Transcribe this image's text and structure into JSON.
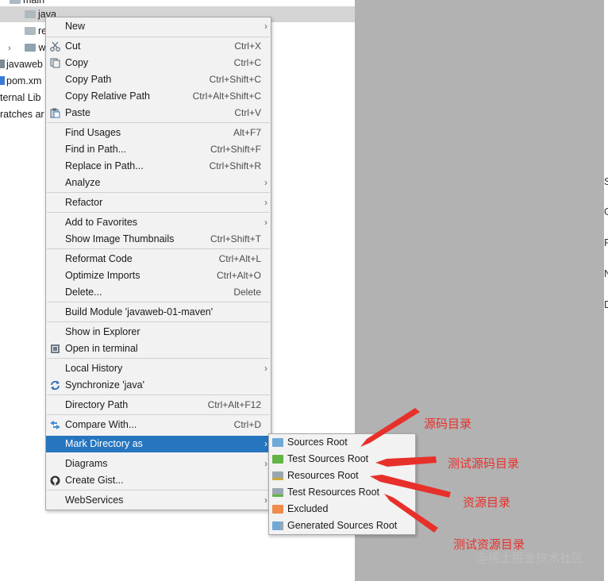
{
  "tree": {
    "main": "main",
    "java": "java",
    "re": "re",
    "w": "w",
    "javaweb": "javaweb",
    "pom": "pom.xm",
    "libs": "ternal Lib",
    "scratches": "ratches ar"
  },
  "editor_strip": [
    "S",
    "G",
    "R",
    "N",
    "D"
  ],
  "menu": {
    "new": "New",
    "cut": "Cut",
    "cut_sc": "Ctrl+X",
    "copy": "Copy",
    "copy_sc": "Ctrl+C",
    "copy_path": "Copy Path",
    "copy_path_sc": "Ctrl+Shift+C",
    "copy_rel": "Copy Relative Path",
    "copy_rel_sc": "Ctrl+Alt+Shift+C",
    "paste": "Paste",
    "paste_sc": "Ctrl+V",
    "find_usages": "Find Usages",
    "find_usages_sc": "Alt+F7",
    "find_in_path": "Find in Path...",
    "find_in_path_sc": "Ctrl+Shift+F",
    "replace_in_path": "Replace in Path...",
    "replace_in_path_sc": "Ctrl+Shift+R",
    "analyze": "Analyze",
    "refactor": "Refactor",
    "add_fav": "Add to Favorites",
    "thumbs": "Show Image Thumbnails",
    "thumbs_sc": "Ctrl+Shift+T",
    "reformat": "Reformat Code",
    "reformat_sc": "Ctrl+Alt+L",
    "optimize": "Optimize Imports",
    "optimize_sc": "Ctrl+Alt+O",
    "delete": "Delete...",
    "delete_sc": "Delete",
    "build": "Build Module 'javaweb-01-maven'",
    "explorer": "Show in Explorer",
    "terminal": "Open in terminal",
    "local_history": "Local History",
    "sync": "Synchronize 'java'",
    "dir_path": "Directory Path",
    "dir_path_sc": "Ctrl+Alt+F12",
    "compare": "Compare With...",
    "compare_sc": "Ctrl+D",
    "mark_dir": "Mark Directory as",
    "diagrams": "Diagrams",
    "gist": "Create Gist...",
    "webservices": "WebServices"
  },
  "submenu": {
    "sources": "Sources Root",
    "test_sources": "Test Sources Root",
    "resources": "Resources Root",
    "test_resources": "Test Resources Root",
    "excluded": "Excluded",
    "generated": "Generated Sources Root"
  },
  "annotations": {
    "a1": "源码目录",
    "a2": "测试源码目录",
    "a3": "资源目录",
    "a4": "测试资源目录"
  },
  "watermark": "@稀土掘金技术社区",
  "colors": {
    "highlight": "#2675bf",
    "annotation": "#e8302b",
    "editor_bg": "#b2b2b2"
  }
}
